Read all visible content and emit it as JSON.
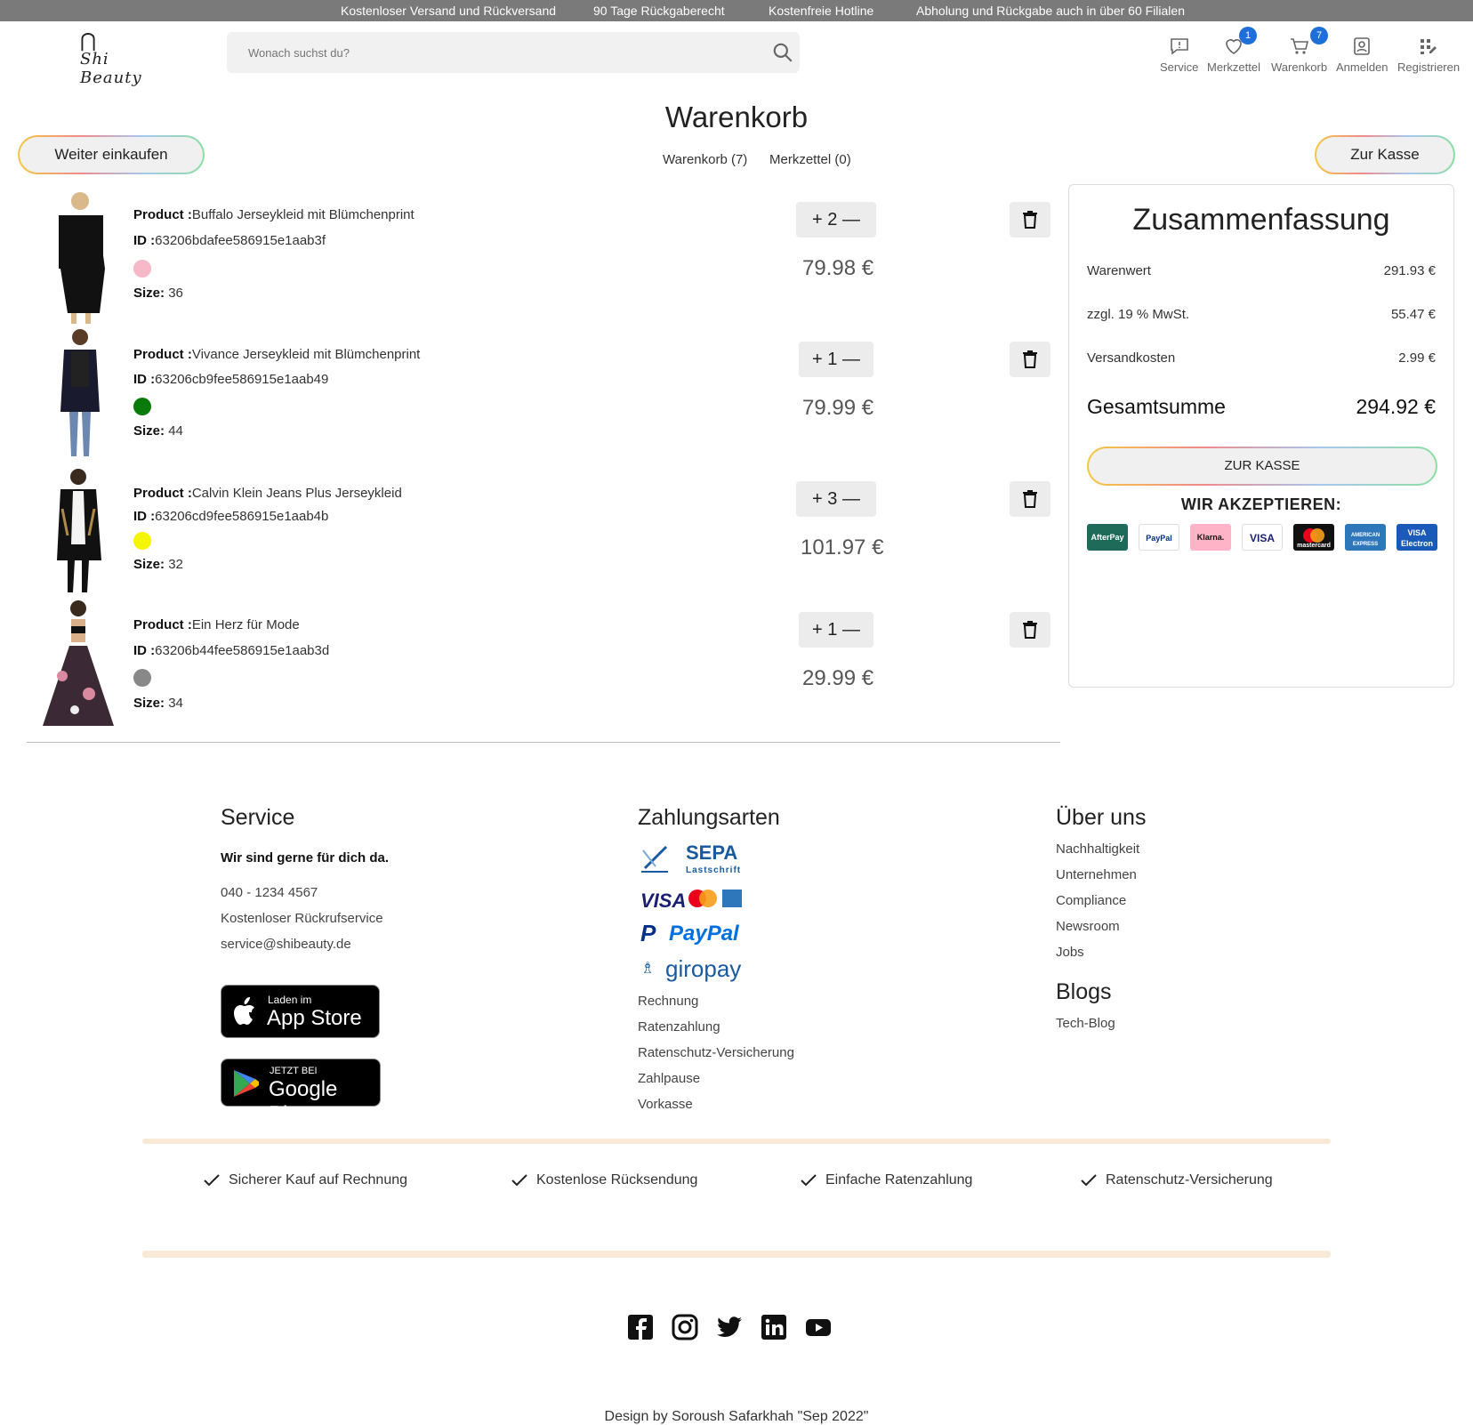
{
  "topbar": {
    "items": [
      "Kostenloser Versand und Rückversand",
      "90 Tage Rückgaberecht",
      "Kostenfreie Hotline",
      "Abholung und Rückgabe auch in über 60 Filialen"
    ]
  },
  "header": {
    "logo_text": "Shi Beauty",
    "search_placeholder": "Wonach suchst du?",
    "nav": [
      {
        "label": "Service",
        "icon": "message-icon"
      },
      {
        "label": "Merkzettel",
        "icon": "heart-icon",
        "badge": "1"
      },
      {
        "label": "Warenkorb",
        "icon": "cart-icon",
        "badge": "7"
      },
      {
        "label": "Anmelden",
        "icon": "user-icon"
      },
      {
        "label": "Registrieren",
        "icon": "register-icon"
      }
    ]
  },
  "cart": {
    "title": "Warenkorb",
    "continue_label": "Weiter einkaufen",
    "checkout_label": "Zur Kasse",
    "tabs": [
      "Warenkorb (7)",
      "Merkzettel (0)"
    ],
    "product_label": "Product :",
    "id_label": "ID :",
    "size_label": "Size:",
    "items": [
      {
        "name": "Buffalo Jerseykleid mit Blümchenprint",
        "id": "63206bdafee586915e1aab3f",
        "color": "#f7b8c8",
        "size": "36",
        "qty": "2",
        "price": "79.98 €"
      },
      {
        "name": "Vivance Jerseykleid mit Blümchenprint",
        "id": "63206cb9fee586915e1aab49",
        "color": "#0a7a0a",
        "size": "44",
        "qty": "1",
        "price": "79.99 €"
      },
      {
        "name": "Calvin Klein Jeans Plus Jerseykleid",
        "id": "63206cd9fee586915e1aab4b",
        "color": "#f5f500",
        "size": "32",
        "qty": "3",
        "price": "101.97 €"
      },
      {
        "name": "Ein Herz für Mode",
        "id": "63206b44fee586915e1aab3d",
        "color": "#888888",
        "size": "34",
        "qty": "1",
        "price": "29.99 €"
      }
    ]
  },
  "summary": {
    "title": "Zusammenfassung",
    "rows": [
      {
        "label": "Warenwert",
        "value": "291.93 €"
      },
      {
        "label": "zzgl. 19 % MwSt.",
        "value": "55.47 €"
      },
      {
        "label": "Versandkosten",
        "value": "2.99 €"
      }
    ],
    "total_label": "Gesamtsumme",
    "total_value": "294.92 €",
    "checkout_label": "ZUR KASSE",
    "accept_label": "WIR AKZEPTIEREN:",
    "payment_logos": [
      {
        "label": "AfterPay",
        "bg": "#1f6b5a",
        "fg": "#ffffff"
      },
      {
        "label": "PayPal",
        "bg": "#ffffff",
        "fg": "#003087"
      },
      {
        "label": "Klarna.",
        "bg": "#ffb3c7",
        "fg": "#111111"
      },
      {
        "label": "VISA",
        "bg": "#ffffff",
        "fg": "#1a1f71"
      },
      {
        "label": "mastercard",
        "bg": "#111111",
        "fg": "#ffffff"
      },
      {
        "label": "AMERICAN EXPRESS",
        "bg": "#2e77bb",
        "fg": "#ffffff"
      },
      {
        "label": "VISA Electron",
        "bg": "#1a5ab8",
        "fg": "#ffffff"
      }
    ]
  },
  "footer": {
    "service": {
      "title": "Service",
      "subtitle": "Wir sind gerne für dich da.",
      "phone": "040 - 1234 4567",
      "callback": "Kostenloser Rückrufservice",
      "email": "service@shibeauty.de",
      "appstore_small": "Laden im",
      "appstore_big": "App Store",
      "googleplay_small": "JETZT BEI",
      "googleplay_big": "Google Play"
    },
    "payment": {
      "title": "Zahlungsarten",
      "sepa": "SEPA",
      "sepa_sub": "Lastschrift",
      "visa": "VISA",
      "paypal": "PayPal",
      "giropay": "giropay",
      "links": [
        "Rechnung",
        "Ratenzahlung",
        "Ratenschutz-Versicherung",
        "Zahlpause",
        "Vorkasse"
      ]
    },
    "about": {
      "title": "Über uns",
      "links": [
        "Nachhaltigkeit",
        "Unternehmen",
        "Compliance",
        "Newsroom",
        "Jobs"
      ],
      "blogs_title": "Blogs",
      "blogs_links": [
        "Tech-Blog"
      ]
    },
    "benefits": [
      "Sicherer Kauf auf Rechnung",
      "Kostenlose Rücksendung",
      "Einfache Ratenzahlung",
      "Ratenschutz-Versicherung"
    ],
    "social": [
      "facebook-icon",
      "instagram-icon",
      "twitter-icon",
      "linkedin-icon",
      "youtube-icon"
    ],
    "credit": "Design by Soroush Safarkhah \"Sep 2022\""
  }
}
